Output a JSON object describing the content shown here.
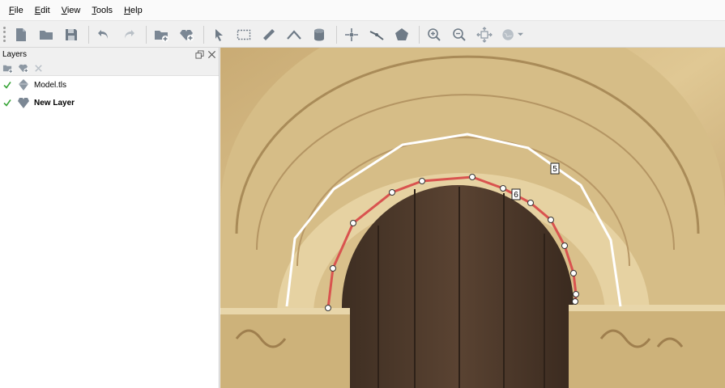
{
  "menu": {
    "file": "File",
    "edit": "Edit",
    "view": "View",
    "tools": "Tools",
    "help": "Help"
  },
  "toolbar": {
    "items": [
      "new-document-icon",
      "open-folder-icon",
      "save-icon",
      "undo-icon",
      "redo-icon",
      "add-folder-icon",
      "add-layer-icon",
      "select-arrow-icon",
      "rectangle-select-icon",
      "ruler-icon",
      "polyline-icon",
      "cylinder-icon",
      "point-tool-icon",
      "line-tool-icon",
      "polygon-tool-icon",
      "zoom-in-icon",
      "zoom-out-icon",
      "zoom-extents-icon",
      "globe-icon"
    ]
  },
  "layers_panel": {
    "title": "Layers",
    "layers": [
      {
        "name": "Model.tls",
        "checked": true,
        "bold": false,
        "icon": "model-icon"
      },
      {
        "name": "New Layer",
        "checked": true,
        "bold": true,
        "icon": "layer-icon"
      }
    ]
  },
  "canvas": {
    "segment_labels": [
      "5",
      "6"
    ]
  },
  "colors": {
    "check": "#3aa53a",
    "red_line": "#d9534f",
    "white_line": "#ffffff",
    "toolbar_icon": "#6f7b87"
  }
}
